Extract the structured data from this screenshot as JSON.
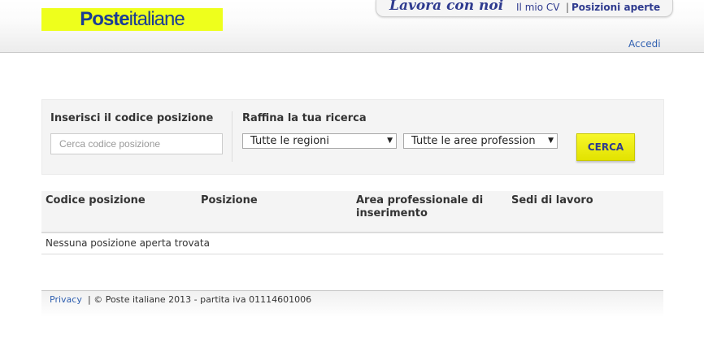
{
  "header": {
    "logo": {
      "bold": "Poste",
      "light": "italiane"
    },
    "nav": {
      "title": "Lavora con noi",
      "mio_cv": "Il mio CV",
      "separator": "|",
      "posizioni_aperte": "Posizioni aperte"
    },
    "accedi": "Accedi"
  },
  "search": {
    "code_label": "Inserisci il codice posizione",
    "code_placeholder": "Cerca codice posizione",
    "code_value": "",
    "refine_label": "Raffina la tua ricerca",
    "regions_select": "Tutte le regioni",
    "areas_select": "Tutte le aree profession",
    "button_label": "CERCA"
  },
  "table": {
    "columns": [
      "Codice posizione",
      "Posizione",
      "Area professionale di inserimento",
      "Sedi di lavoro"
    ],
    "empty_message": "Nessuna posizione aperta trovata"
  },
  "footer": {
    "privacy": "Privacy",
    "text": "| © Poste italiane 2013 - partita iva 01114601006"
  },
  "icons": {
    "select_arrow": "triangle-down-icon"
  },
  "colors": {
    "brand_yellow": "#eeff1c",
    "brand_blue": "#1a3d94",
    "link_blue": "#2f5fb0",
    "button_yellow": "#f7f72a"
  }
}
